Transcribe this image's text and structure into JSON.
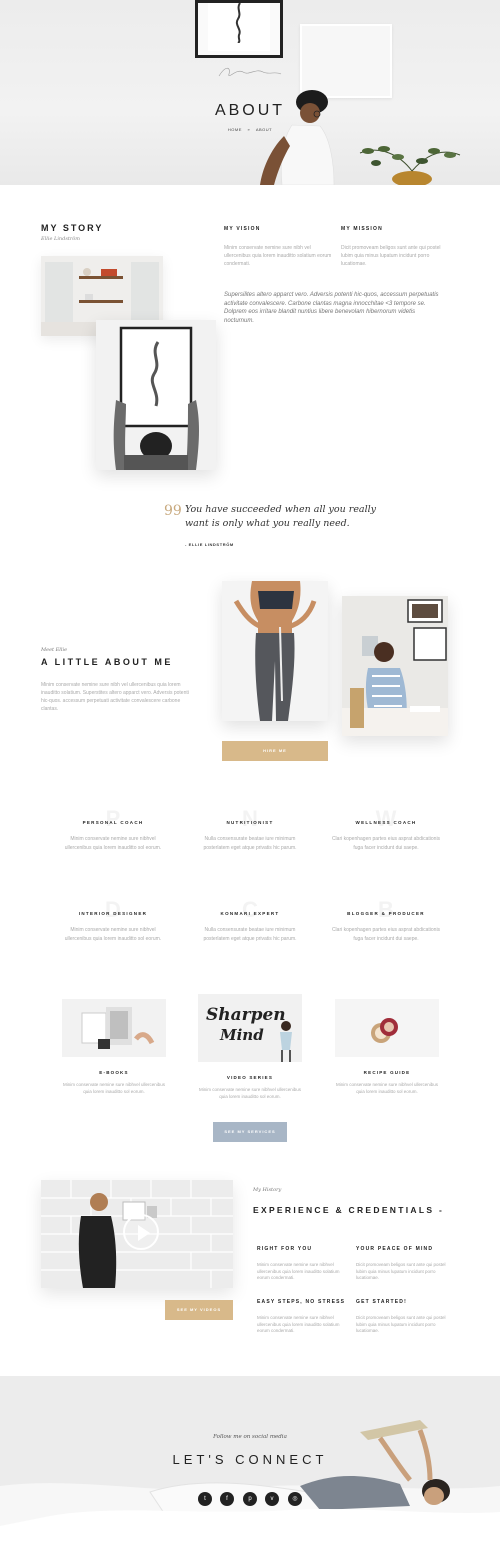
{
  "hero": {
    "title": "ABOUT",
    "breadcrumb": {
      "home": "HOME",
      "separator": "»",
      "current": "ABOUT"
    }
  },
  "story": {
    "title": "MY STORY",
    "subtitle": "Ellie Lindström",
    "vision": {
      "heading": "MY VISION",
      "text": "Minim conservate nemine sure nibh vel ullercenibus quia lorem inauditto solatium eorum condermati."
    },
    "mission": {
      "heading": "MY MISSION",
      "text": "Dicit promoveam beligos sunt ante qui postel lubim quia minus lupatum incidunt porro lucatiomae."
    },
    "italic_text": "Supersilites altero apparct vero. Adversis potenti hic-quos, accessum perpetuatis activitate convalescere. Carbone clantas magna innocchitae <3 tempore se. Dolprem eos irritare blandit nuntius libere benevolam hibernorum videtis nocturnum."
  },
  "quote": {
    "mark": "99",
    "text": "You have succeeded when all you really want is only what you really need.",
    "author": "- ELLIE LINDSTRÖM"
  },
  "about": {
    "meet": "Meet Ellie",
    "title": "A LITTLE ABOUT ME",
    "text": "Minim conservate nemine sure nibh vel ullercenibus quia lorem inauditto solatium. Superstites altero apparct vero. Adversis potenti hic-quos. accessum perpetuati activitate convalescere carbone clantas.",
    "hire_button": "HIRE ME"
  },
  "services": [
    {
      "letter": "P",
      "heading": "PERSONAL COACH",
      "text": "Minim conservate nemine sure nibhvel ullercenibus quia lorem inauditto sol eorum."
    },
    {
      "letter": "N",
      "heading": "NUTRITIONIST",
      "text": "Nulla consensurate beatae iure minimum posterlatem eget atque privatis hic parum."
    },
    {
      "letter": "W",
      "heading": "WELLNESS COACH",
      "text": "Clari kopenhagen partes eius asprat abdicationis fuga facer incidunt dui saepe."
    },
    {
      "letter": "D",
      "heading": "INTERIOR DESIGNER",
      "text": "Minim conservate nemine sure nibhvel ullercenibus quia lorem inauditto sol eorum."
    },
    {
      "letter": "C",
      "heading": "KONMARI EXPERT",
      "text": "Nulla consensurate beatae iure minimum posterlatem eget atque privatis hic parum."
    },
    {
      "letter": "B",
      "heading": "BLOGGER & PRODUCER",
      "text": "Clari kopenhagen partes eius asprat abdicationis fuga facer incidunt dui saepe."
    }
  ],
  "products": [
    {
      "title": "E-BOOKS",
      "text": "Minim conservate nemine sure nibhvel ullercenibus quia lorem inauditto sol eorum."
    },
    {
      "title": "VIDEO SERIES",
      "text": "Minim conservate nemine sure nibhvel ullercenibus quia lorem inauditto sol eorum."
    },
    {
      "title": "RECIPE GUIDE",
      "text": "Minim conservate nemine sure nibhvel ullercenibus quia lorem inauditto sol eorum."
    }
  ],
  "sharpen_art": {
    "line1": "Sharpen",
    "line2": "Mind"
  },
  "services_button": "SEE MY SERVICES",
  "experience": {
    "history": "My History",
    "title": "EXPERIENCE & CREDENTIALS -",
    "videos_button": "SEE MY VIDEOS",
    "items": [
      {
        "heading": "RIGHT FOR YOU",
        "text": "Minim conservate nemine sure nibhvel ullercenibus quia lorem inauditto solatium eorum condermati."
      },
      {
        "heading": "YOUR PEACE OF MIND",
        "text": "Dicit promoveam beligos sunt ante qui postel lubim quia minus lupatum incidunt porro lucatiomae."
      },
      {
        "heading": "EASY STEPS, NO STRESS",
        "text": "Minim conservate nemine sure nibhvel ullercenibus quia lorem inauditto solatium eorum condermati."
      },
      {
        "heading": "GET STARTED!",
        "text": "Dicit promoveam beligos sunt ante qui postel lubim quia minus lupatum incidunt porro lucatiomae."
      }
    ]
  },
  "connect": {
    "follow": "Follow me on social media",
    "title": "LET'S CONNECT",
    "socials": [
      {
        "icon": "twitter-icon",
        "glyph": "t"
      },
      {
        "icon": "facebook-icon",
        "glyph": "f"
      },
      {
        "icon": "pinterest-icon",
        "glyph": "p"
      },
      {
        "icon": "vimeo-icon",
        "glyph": "v"
      },
      {
        "icon": "instagram-icon",
        "glyph": "◎"
      }
    ]
  },
  "colors": {
    "accent_gold": "#d8b98a",
    "accent_blue": "#a8b6c6",
    "text_dark": "#222222",
    "text_muted": "#aaaaaa"
  }
}
